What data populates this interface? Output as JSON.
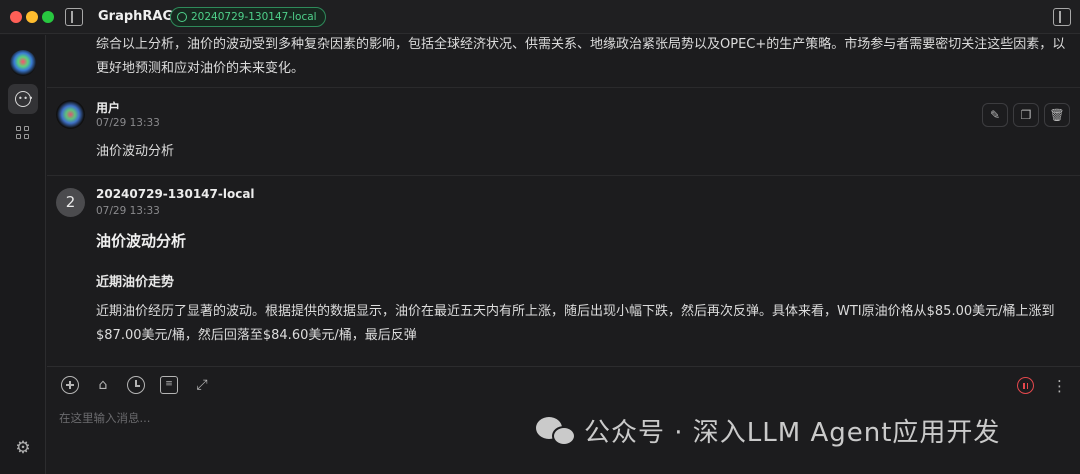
{
  "titlebar": {
    "app_name": "GraphRAG",
    "model_badge": "20240729-130147-local"
  },
  "sidebar": {
    "items": [
      "avatar",
      "chat",
      "plugins"
    ],
    "settings": "settings"
  },
  "messages": {
    "previous": {
      "text": "综合以上分析，油价的波动受到多种复杂因素的影响，包括全球经济状况、供需关系、地缘政治紧张局势以及OPEC+的生产策略。市场参与者需要密切关注这些因素，以更好地预测和应对油价的未来变化。"
    },
    "user": {
      "name": "用户",
      "time": "07/29 13:33",
      "text": "油价波动分析"
    },
    "assistant": {
      "avatar_label": "2",
      "name": "20240729-130147-local",
      "time": "07/29 13:33",
      "heading": "油价波动分析",
      "subheading": "近期油价走势",
      "text": "近期油价经历了显著的波动。根据提供的数据显示，油价在最近五天内有所上涨，随后出现小幅下跌，然后再次反弹。具体来看，WTI原油价格从$85.00美元/桶上涨到$87.00美元/桶，然后回落至$84.60美元/桶，最后反弹"
    }
  },
  "input": {
    "placeholder": "在这里输入消息..."
  },
  "watermark": {
    "text": "公众号 · 深入LLM Agent应用开发"
  },
  "colors": {
    "background": "#1c1c1e",
    "badge_green": "#4fd08a",
    "stop_red": "#e5484d"
  }
}
